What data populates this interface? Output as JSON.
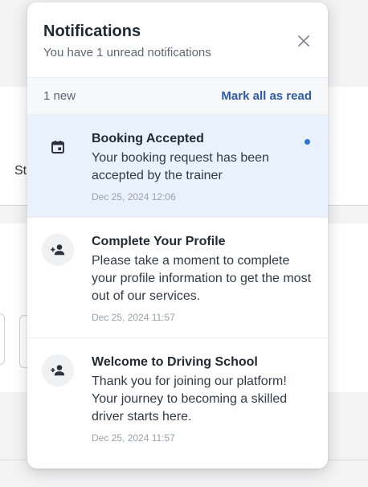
{
  "background": {
    "stub_text": "St"
  },
  "panel": {
    "title": "Notifications",
    "subtitle": "You have 1 unread notifications",
    "close_icon": "close-icon",
    "new_count": "1 new",
    "mark_all_label": "Mark all as read",
    "accent_color": "#2f5aa8",
    "unread_bg_color": "#e9f1fc",
    "notifications": [
      {
        "icon": "calendar-icon",
        "title": "Booking Accepted",
        "message": "Your booking request has been accepted by the trainer",
        "timestamp": "Dec 25, 2024 12:06",
        "unread": true
      },
      {
        "icon": "person-add-icon",
        "title": "Complete Your Profile",
        "message": "Please take a moment to complete your profile information to get the most out of our services.",
        "timestamp": "Dec 25, 2024 11:57",
        "unread": false
      },
      {
        "icon": "person-add-icon",
        "title": "Welcome to Driving School",
        "message": "Thank you for joining our platform! Your journey to becoming a skilled driver starts here.",
        "timestamp": "Dec 25, 2024 11:57",
        "unread": false
      }
    ]
  }
}
